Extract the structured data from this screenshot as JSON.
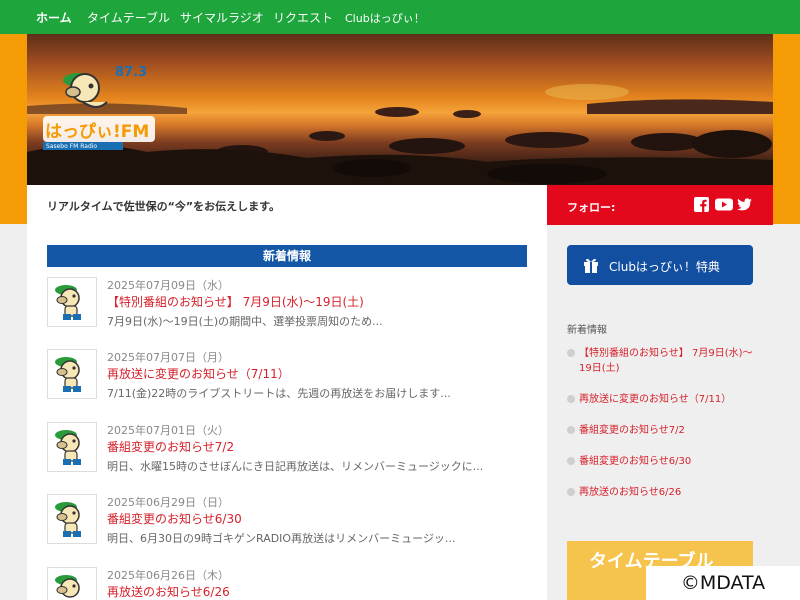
{
  "nav": {
    "items": [
      {
        "label": "ホーム"
      },
      {
        "label": "タイムテーブル"
      },
      {
        "label": "サイマルラジオ"
      },
      {
        "label": "リクエスト"
      },
      {
        "label": "Clubはっぴぃ！"
      }
    ]
  },
  "logo": {
    "frequency": "87.3",
    "name": "はっぴぃ!FM",
    "sub": "Sasebo FM Radio"
  },
  "tagline": "リアルタイムで佐世保の“今”をお伝えします。",
  "follow": {
    "label": "フォロー:",
    "icons": [
      "facebook-icon",
      "youtube-icon",
      "twitter-icon"
    ]
  },
  "news": {
    "header": "新着情報",
    "items": [
      {
        "date": "2025年07月09日（水）",
        "title": "【特別番組のお知らせ】 7月9日(水)〜19日(土)",
        "excerpt": "7月9日(水)〜19日(土)の期間中、選挙投票周知のため..."
      },
      {
        "date": "2025年07月07日（月）",
        "title": "再放送に変更のお知らせ（7/11）",
        "excerpt": "7/11(金)22時のライブストリートは、先週の再放送をお届けします..."
      },
      {
        "date": "2025年07月01日（火）",
        "title": "番組変更のお知らせ7/2",
        "excerpt": "明日、水曜15時のさせぼんにき日記再放送は、リメンバーミュージックに..."
      },
      {
        "date": "2025年06月29日（日）",
        "title": "番組変更のお知らせ6/30",
        "excerpt": "明日、6月30日の9時ゴキゲンRADIO再放送はリメンバーミュージッ..."
      },
      {
        "date": "2025年06月26日（木）",
        "title": "再放送のお知らせ6/26",
        "excerpt": ""
      }
    ]
  },
  "sidebar": {
    "club_button": "Clubはっぴぃ！特典",
    "heading": "新着情報",
    "items": [
      "【特別番組のお知らせ】 7月9日(水)〜19日(土)",
      "再放送に変更のお知らせ（7/11）",
      "番組変更のお知らせ7/2",
      "番組変更のお知らせ6/30",
      "再放送のお知らせ6/26"
    ],
    "banner": "タイムテーブル"
  },
  "copyright": "©MDATA",
  "colors": {
    "nav": "#1ea53b",
    "accent_orange": "#f49b05",
    "follow_red": "#e4081d",
    "news_blue": "#1357a6",
    "link_red": "#d6212b"
  }
}
